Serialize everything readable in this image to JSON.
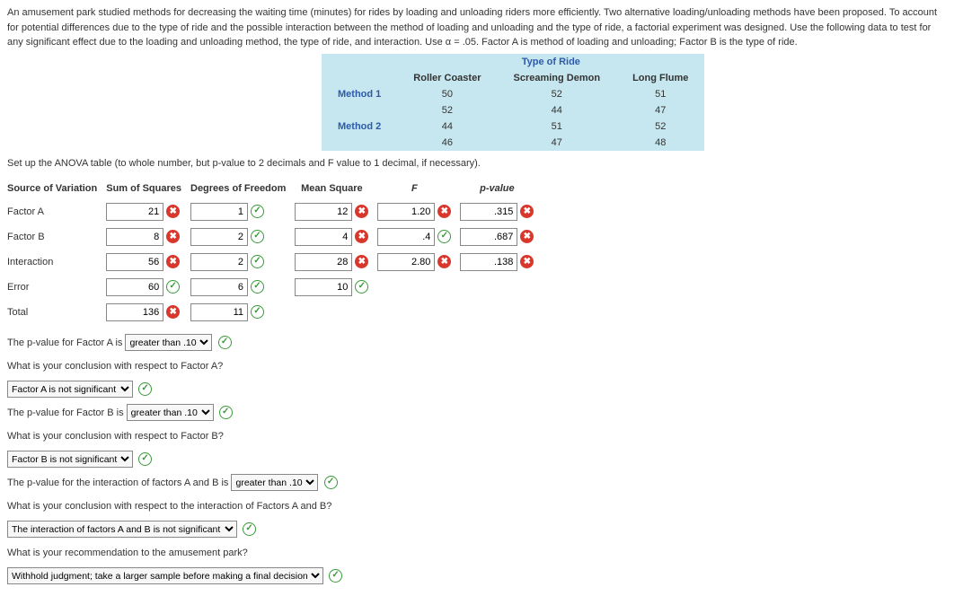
{
  "intro": "An amusement park studied methods for decreasing the waiting time (minutes) for rides by loading and unloading riders more efficiently. Two alternative loading/unloading methods have been proposed. To account for potential differences due to the type of ride and the possible interaction between the method of loading and unloading and the type of ride, a factorial experiment was designed. Use the following data to test for any significant effect due to the loading and unloading method, the type of ride, and interaction. Use α = .05. Factor A is method of loading and unloading; Factor B is the type of ride.",
  "data_table": {
    "type_header": "Type of Ride",
    "cols": [
      "Roller Coaster",
      "Screaming Demon",
      "Long Flume"
    ],
    "methods": [
      "Method 1",
      "Method 2"
    ],
    "values": [
      [
        "50",
        "52",
        "51"
      ],
      [
        "52",
        "44",
        "47"
      ],
      [
        "44",
        "51",
        "52"
      ],
      [
        "46",
        "47",
        "48"
      ]
    ]
  },
  "setup_text": "Set up the ANOVA table (to whole number, but p-value to 2 decimals and F value to 1 decimal, if necessary).",
  "anova": {
    "headers": [
      "Source of Variation",
      "Sum of Squares",
      "Degrees of Freedom",
      "Mean Square",
      "F",
      "p-value"
    ],
    "rows": [
      {
        "label": "Factor A",
        "ss": "21",
        "ss_ok": false,
        "df": "1",
        "df_ok": true,
        "ms": "12",
        "ms_ok": false,
        "f": "1.20",
        "f_ok": false,
        "p": ".315",
        "p_ok": false
      },
      {
        "label": "Factor B",
        "ss": "8",
        "ss_ok": false,
        "df": "2",
        "df_ok": true,
        "ms": "4",
        "ms_ok": false,
        "f": ".4",
        "f_ok": true,
        "p": ".687",
        "p_ok": false
      },
      {
        "label": "Interaction",
        "ss": "56",
        "ss_ok": false,
        "df": "2",
        "df_ok": true,
        "ms": "28",
        "ms_ok": false,
        "f": "2.80",
        "f_ok": false,
        "p": ".138",
        "p_ok": false
      },
      {
        "label": "Error",
        "ss": "60",
        "ss_ok": true,
        "df": "6",
        "df_ok": true,
        "ms": "10",
        "ms_ok": true
      },
      {
        "label": "Total",
        "ss": "136",
        "ss_ok": false,
        "df": "11",
        "df_ok": true
      }
    ]
  },
  "q": {
    "pA_pre": "The p-value for Factor A is",
    "pA_val": "greater than .10",
    "cA_q": "What is your conclusion with respect to Factor A?",
    "cA_val": "Factor A is not significant",
    "pB_pre": "The p-value for Factor B is",
    "pB_val": "greater than .10",
    "cB_q": "What is your conclusion with respect to Factor B?",
    "cB_val": "Factor B is not significant",
    "pAB_pre": "The p-value for the interaction of factors A and B is",
    "pAB_val": "greater than .10",
    "cAB_q": "What is your conclusion with respect to the interaction of Factors A and B?",
    "cAB_val": "The interaction of factors A and B is not significant",
    "rec_q": "What is your recommendation to the amusement park?",
    "rec_val": "Withhold judgment; take a larger sample before making a final decision"
  }
}
